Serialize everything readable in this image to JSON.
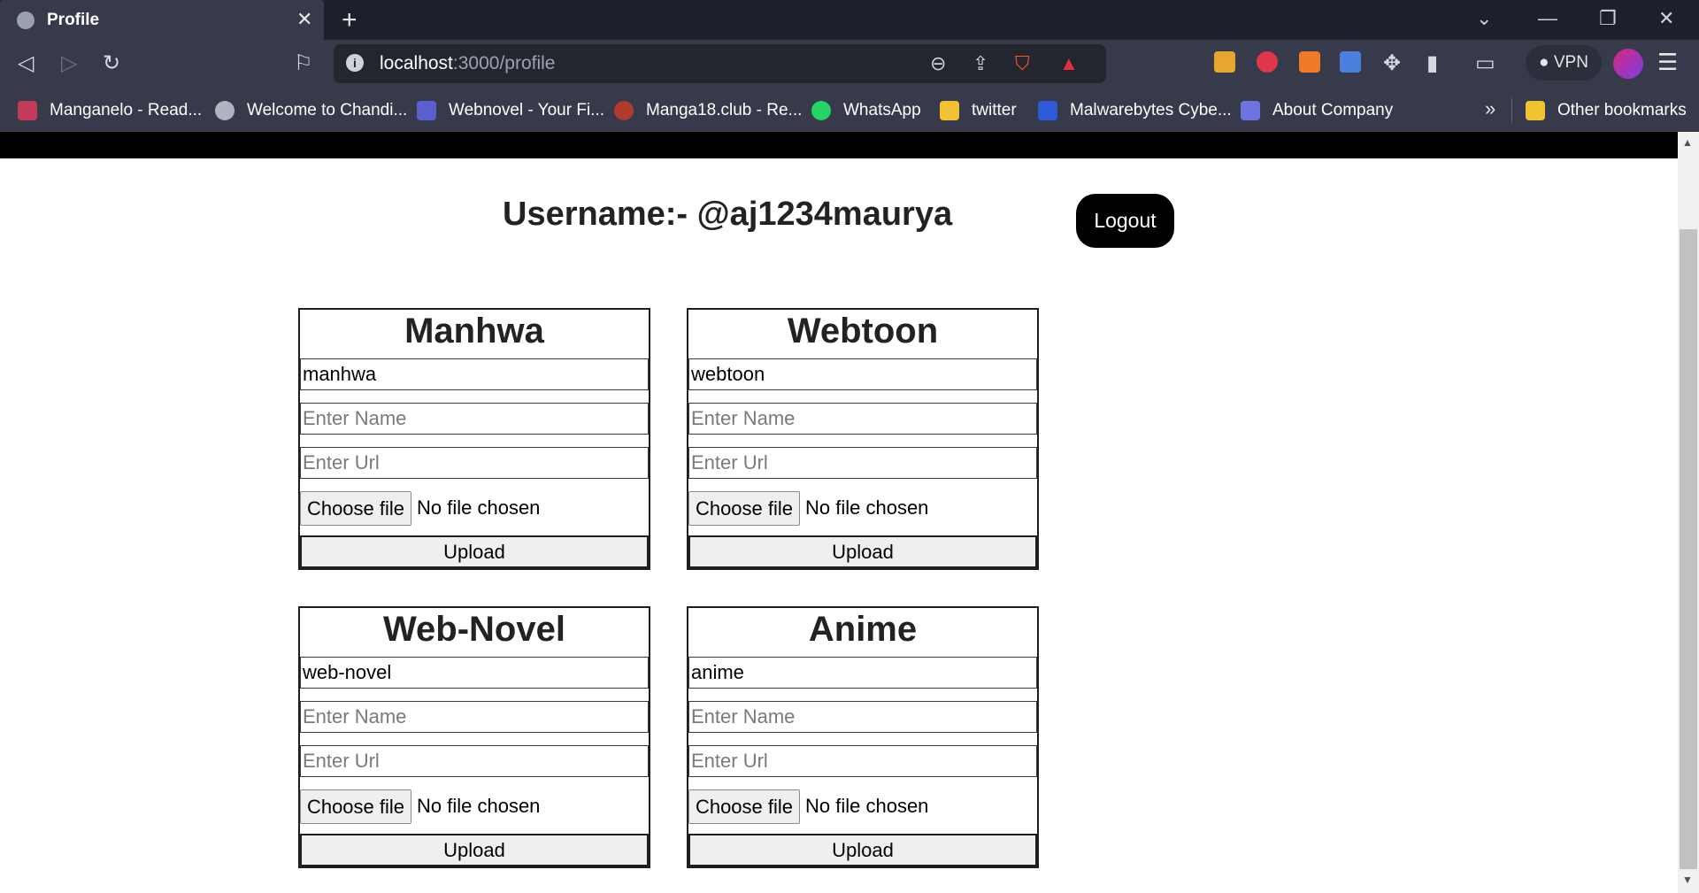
{
  "browser": {
    "tab_title": "Profile",
    "url_host": "localhost",
    "url_path": ":3000/profile",
    "vpn_label": "VPN",
    "bookmarks": [
      {
        "label": "Manganelo - Read...",
        "color": "#c33b5a"
      },
      {
        "label": "Welcome to Chandi...",
        "color": "#b0b4bf"
      },
      {
        "label": "Webnovel - Your Fi...",
        "color": "#5a5fd0"
      },
      {
        "label": "Manga18.club - Re...",
        "color": "#b23a2a"
      },
      {
        "label": "WhatsApp",
        "color": "#25d366"
      },
      {
        "label": "twitter",
        "color": "#f1c232"
      },
      {
        "label": "Malwarebytes Cybe...",
        "color": "#2f5bd9"
      },
      {
        "label": "About Company",
        "color": "#6d74e0"
      }
    ],
    "other_bookmarks": "Other bookmarks"
  },
  "page": {
    "username_label": "Username:- @aj1234maurya",
    "logout_label": "Logout",
    "cards": [
      {
        "title": "Manhwa",
        "category_value": "manhwa",
        "name_placeholder": "Enter Name",
        "url_placeholder": "Enter Url",
        "file_button": "Choose file",
        "file_status": "No file chosen",
        "upload_label": "Upload"
      },
      {
        "title": "Webtoon",
        "category_value": "webtoon",
        "name_placeholder": "Enter Name",
        "url_placeholder": "Enter Url",
        "file_button": "Choose file",
        "file_status": "No file chosen",
        "upload_label": "Upload"
      },
      {
        "title": "Web-Novel",
        "category_value": "web-novel",
        "name_placeholder": "Enter Name",
        "url_placeholder": "Enter Url",
        "file_button": "Choose file",
        "file_status": "No file chosen",
        "upload_label": "Upload"
      },
      {
        "title": "Anime",
        "category_value": "anime",
        "name_placeholder": "Enter Name",
        "url_placeholder": "Enter Url",
        "file_button": "Choose file",
        "file_status": "No file chosen",
        "upload_label": "Upload"
      }
    ]
  }
}
